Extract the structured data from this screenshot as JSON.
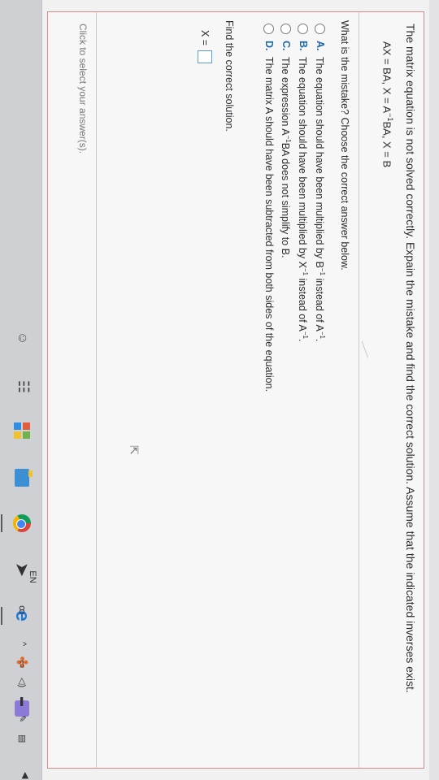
{
  "question": {
    "prompt": "The matrix equation is not solved correctly. Expain the mistake and find the correct solution. Assume that the indicated inverses exist.",
    "equation_part1": "AX = BA, X = A",
    "equation_exp": "−1",
    "equation_part2": "BA, X = B"
  },
  "sub_question": "What is the mistake? Choose the correct answer below.",
  "options": [
    {
      "letter": "A.",
      "text_a": "The equation should have been multiplied by B",
      "sup_a": "−1",
      "text_b": " instead of A",
      "sup_b": "−1",
      "text_c": "."
    },
    {
      "letter": "B.",
      "text_a": "The equation should have been multiplied by X",
      "sup_a": "−1",
      "text_b": " instead of A",
      "sup_b": "−1",
      "text_c": "."
    },
    {
      "letter": "C.",
      "text_a": "The expression A",
      "sup_a": "−1",
      "text_b": "BA does not simplify to B.",
      "sup_b": "",
      "text_c": ""
    },
    {
      "letter": "D.",
      "text_a": "The matrix A should have been subtracted from both sides of the equation.",
      "sup_a": "",
      "text_b": "",
      "sup_b": "",
      "text_c": ""
    }
  ],
  "find_prompt": "Find the correct solution.",
  "answer_label": "X =",
  "hint": "Click to select your answer(s).",
  "taskbar": {
    "language": "EN",
    "icons": [
      "person-icon",
      "people-icon",
      "store-icon",
      "file-explorer-icon",
      "chrome-icon",
      "arrow-app-icon",
      "edge-icon",
      "pinwheel-icon",
      "photos-icon"
    ]
  }
}
